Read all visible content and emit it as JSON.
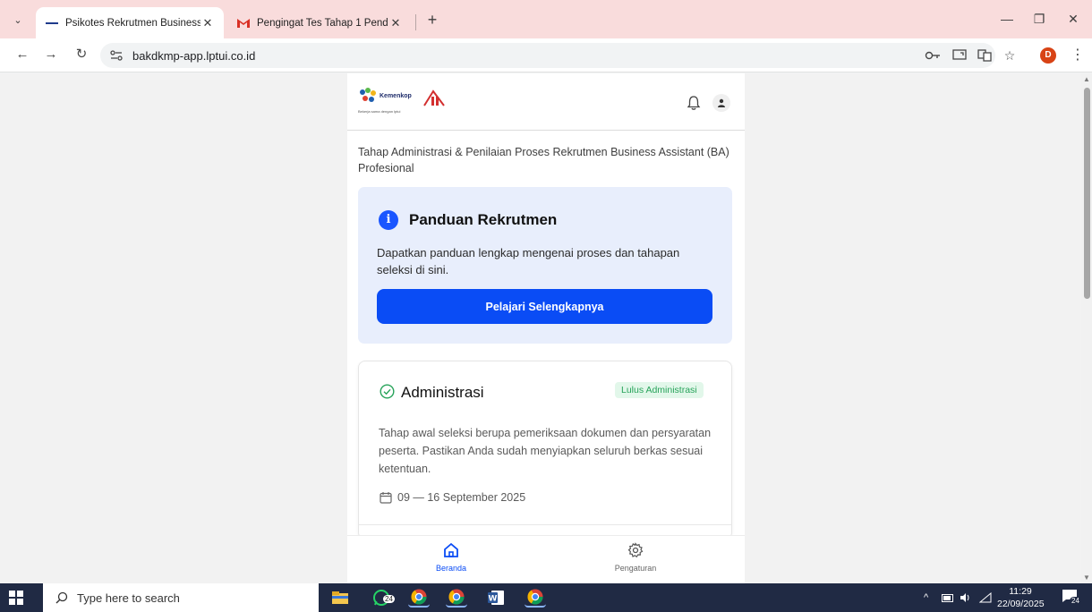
{
  "browser": {
    "tabs": [
      {
        "title": "Psikotes Rekrutmen Business As",
        "active": true
      },
      {
        "title": "Pengingat Tes Tahap 1 Pendafta",
        "active": false
      }
    ],
    "url": "bakdkmp-app.lptui.co.id",
    "profile_initial": "D"
  },
  "app": {
    "logo_text": "Kemenkop",
    "logo_sub": "Bekerja sama dengan lptui",
    "heading": "Tahap Administrasi & Penilaian Proses Rekrutmen Business Assistant (BA) Profesional",
    "guide": {
      "title": "Panduan Rekrutmen",
      "description": "Dapatkan panduan lengkap mengenai proses dan tahapan seleksi di sini.",
      "button_label": "Pelajari Selengkapnya"
    },
    "admin": {
      "title": "Administrasi",
      "status": "Lulus Administrasi",
      "description": "Tahap awal seleksi berupa pemeriksaan dokumen dan persyaratan peserta. Pastikan Anda sudah menyiapkan seluruh berkas sesuai ketentuan.",
      "date": "09 — 16 September 2025"
    },
    "nav": {
      "home": "Beranda",
      "settings": "Pengaturan"
    }
  },
  "taskbar": {
    "search_placeholder": "Type here to search",
    "time": "11:29",
    "date": "22/09/2025",
    "badge_count": "24",
    "notif_count": "24"
  },
  "colors": {
    "accent": "#0a4cf5",
    "tab_strip": "#f9dcdc",
    "success": "#27a35a",
    "guide_bg": "#e8eefc"
  }
}
